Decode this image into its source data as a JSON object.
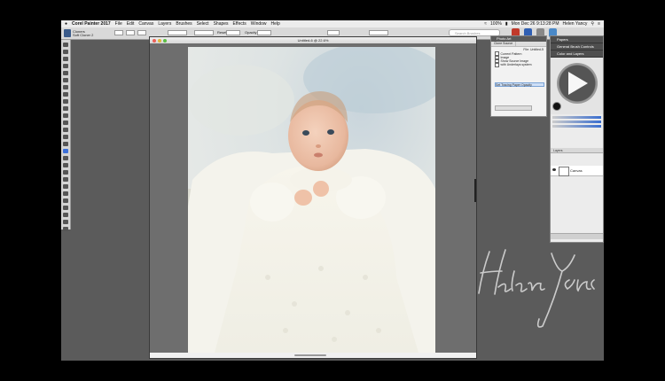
{
  "menubar": {
    "apple": "",
    "app_name": "Corel Painter 2017",
    "items": [
      "File",
      "Edit",
      "Canvas",
      "Layers",
      "Brushes",
      "Select",
      "Shapes",
      "Effects",
      "Window",
      "Help"
    ],
    "battery": "100%",
    "datetime": "Mon Dec 26  9:13:28 PM",
    "user": "Helen Yancy"
  },
  "propbar": {
    "brush_category": "Cloners",
    "brush_variant": "Soft Cloner 2",
    "size_label": "",
    "opacity_value": "",
    "reset_label": "Reset",
    "opacity_label": "Opacity",
    "search_placeholder": "Search Brushes"
  },
  "document": {
    "title": "Untitled-6 @ 22.6%"
  },
  "photo_art_panel": {
    "title": "Photo Art",
    "subtab_1": "Clone Source",
    "source_label": "File: Untitled-5",
    "opt_1": "Current Pattern",
    "opt_2": "Image",
    "opt_3": "Show Source Image",
    "opt_4": "with Underlays system",
    "tracing_label": "Set Tracing Paper Opacity"
  },
  "right_panels": {
    "papers": "Papers",
    "brush_controls": "General Brush Controls",
    "color_layers": "Color and Layers",
    "layers_tab": "Layers",
    "layer_name": "Canvas"
  },
  "watermark": {
    "signature": "Helen Yancy"
  },
  "colors": {
    "accent": "#3c6fd8",
    "panel_header": "#4e4e4e",
    "desktop": "#5b5b5b"
  }
}
